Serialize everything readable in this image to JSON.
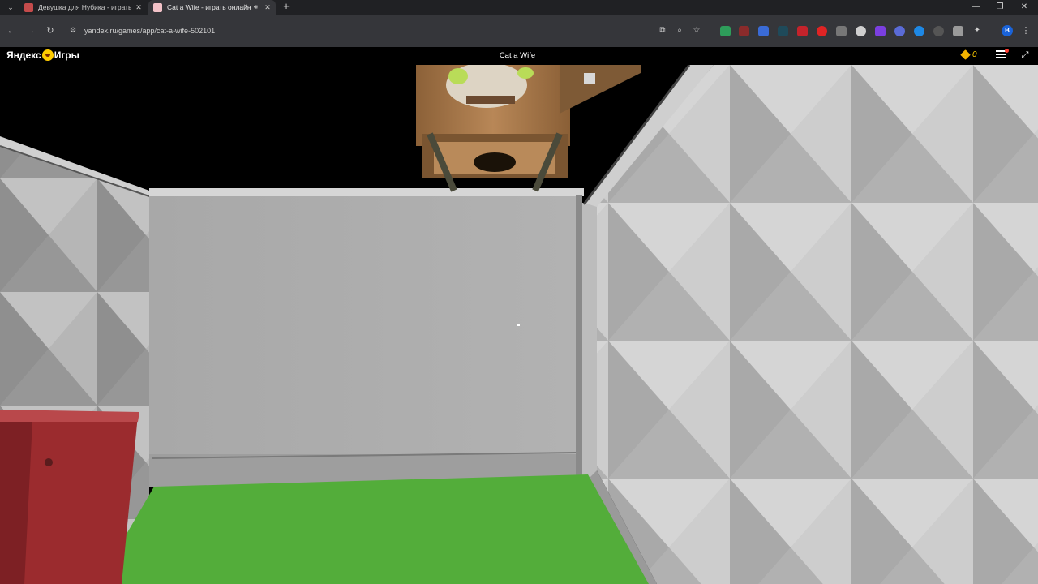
{
  "browser": {
    "tabs": [
      {
        "title": "Девушка для Нубика - играть",
        "active": false
      },
      {
        "title": "Cat a Wife - играть онлайн",
        "active": true
      }
    ],
    "new_tab_symbol": "+",
    "url": "yandex.ru/games/app/cat-a-wife-502101",
    "window_controls": [
      "minimize-icon",
      "restore-icon",
      "close-icon"
    ],
    "profile_initial": "B"
  },
  "site": {
    "logo": {
      "left": "Яндекс",
      "right": "Игры"
    },
    "game_title": "Cat a Wife",
    "coins": "0"
  },
  "colors": {
    "tabbar": "#202124",
    "toolbar": "#35363a",
    "floor_green": "#53ad3a",
    "wall_gray": "#aaaaaa",
    "crate_wood": "#a97a4d",
    "bin_red": "#9b2b2e",
    "coin": "#f4b400"
  }
}
